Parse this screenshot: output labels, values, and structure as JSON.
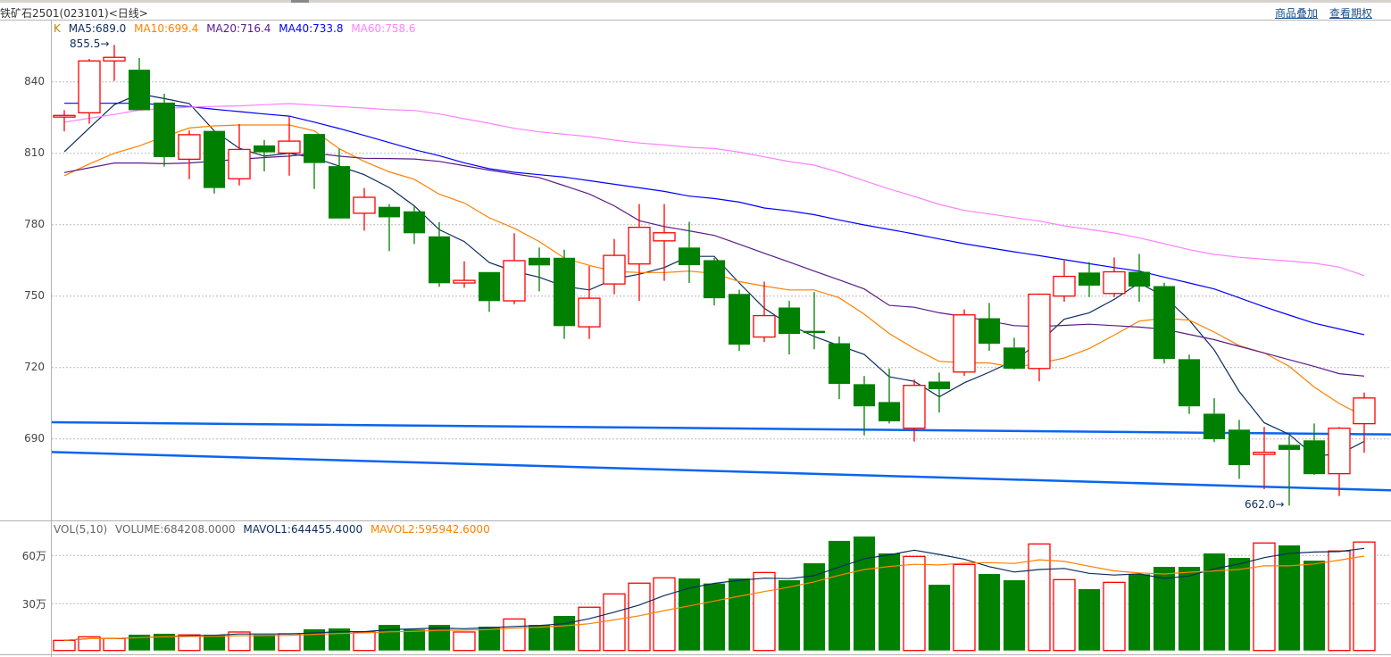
{
  "header": {
    "title": "铁矿石2501(023101)<日线>",
    "links": [
      "商品叠加",
      "查看期权"
    ]
  },
  "legend": {
    "k_label": "K",
    "items": [
      {
        "text": "MA5:689.0",
        "color": "#0b2d5e"
      },
      {
        "text": "MA10:699.4",
        "color": "#ff8000"
      },
      {
        "text": "MA20:716.4",
        "color": "#5a1a8a"
      },
      {
        "text": "MA40:733.8",
        "color": "#0000ff"
      },
      {
        "text": "MA60:758.6",
        "color": "#ff80ff"
      }
    ]
  },
  "volume_legend": {
    "items": [
      {
        "text": "VOL(5,10)",
        "color": "#666666"
      },
      {
        "text": "VOLUME:684208.0000",
        "color": "#666666"
      },
      {
        "text": "MAVOL1:644455.4000",
        "color": "#0b2d5e"
      },
      {
        "text": "MAVOL2:595942.6000",
        "color": "#ff8000"
      }
    ]
  },
  "colors": {
    "up": "#ff0000",
    "down": "#008000",
    "grid": "#bbbbbb",
    "trendline": "#0a64f0"
  },
  "chart_data": {
    "type": "candlestick",
    "title": "铁矿石2501(023101)<日线>",
    "price_axis": {
      "ticks": [
        840,
        810,
        780,
        750,
        720,
        690
      ],
      "tick_labels": [
        "840",
        "810",
        "780",
        "750",
        "720",
        "690"
      ]
    },
    "volume_axis": {
      "unit": "万",
      "ticks": [
        60,
        30
      ],
      "tick_labels": [
        "60万",
        "30万"
      ]
    },
    "grid": true,
    "annotations": [
      {
        "text": "855.5→",
        "candle": 2,
        "price": 855.5,
        "kind": "high"
      },
      {
        "text": "662.0→",
        "candle": 49,
        "price": 662.0,
        "kind": "low"
      }
    ],
    "ohlc": [
      [
        825.2,
        828.1,
        819.2,
        825.9
      ],
      [
        827.0,
        849.6,
        822.4,
        848.8
      ],
      [
        848.8,
        855.5,
        840.4,
        850.3
      ],
      [
        845.1,
        850.0,
        828.1,
        828.1
      ],
      [
        831.3,
        835.0,
        804.4,
        808.4
      ],
      [
        807.5,
        819.6,
        799.1,
        817.8
      ],
      [
        819.4,
        819.4,
        793.1,
        795.4
      ],
      [
        799.3,
        822.3,
        796.5,
        811.6
      ],
      [
        813.3,
        815.6,
        802.4,
        810.4
      ],
      [
        810.1,
        825.4,
        800.6,
        815.1
      ],
      [
        818.1,
        818.1,
        795.0,
        805.9
      ],
      [
        804.6,
        811.9,
        782.6,
        782.6
      ],
      [
        784.8,
        795.4,
        777.5,
        791.5
      ],
      [
        787.5,
        788.6,
        768.9,
        783.1
      ],
      [
        785.6,
        787.6,
        771.9,
        776.4
      ],
      [
        775.1,
        781.1,
        753.9,
        755.4
      ],
      [
        755.5,
        764.6,
        753.5,
        756.6
      ],
      [
        760.1,
        760.1,
        743.4,
        747.9
      ],
      [
        748.0,
        776.4,
        746.6,
        764.9
      ],
      [
        766.1,
        770.4,
        752.0,
        762.9
      ],
      [
        766.1,
        769.5,
        732.0,
        737.4
      ],
      [
        737.1,
        762.6,
        732.0,
        749.1
      ],
      [
        755.1,
        774.0,
        750.8,
        767.1
      ],
      [
        763.5,
        788.7,
        748.0,
        778.9
      ],
      [
        773.2,
        788.7,
        756.4,
        776.6
      ],
      [
        770.4,
        781.2,
        755.5,
        763.0
      ],
      [
        765.1,
        766.0,
        746.1,
        749.1
      ],
      [
        750.9,
        752.7,
        727.0,
        729.6
      ],
      [
        732.8,
        756.1,
        730.7,
        741.8
      ],
      [
        745.2,
        748.0,
        725.5,
        734.1
      ],
      [
        735.4,
        751.7,
        727.7,
        734.5
      ],
      [
        730.2,
        733.0,
        706.7,
        713.1
      ],
      [
        713.0,
        716.4,
        691.5,
        703.7
      ],
      [
        705.5,
        719.6,
        696.5,
        697.4
      ],
      [
        694.5,
        714.9,
        688.9,
        712.5
      ],
      [
        714.1,
        717.9,
        701.1,
        710.9
      ],
      [
        718.1,
        744.4,
        716.5,
        742.1
      ],
      [
        740.7,
        747.1,
        727.0,
        730.0
      ],
      [
        728.4,
        732.5,
        719.2,
        719.5
      ],
      [
        719.6,
        751.1,
        714.2,
        750.8
      ],
      [
        750.0,
        764.9,
        747.6,
        758.3
      ],
      [
        759.9,
        764.3,
        749.6,
        754.4
      ],
      [
        751.1,
        766.2,
        749.6,
        760.2
      ],
      [
        760.2,
        767.7,
        747.6,
        754.0
      ],
      [
        754.2,
        755.6,
        721.7,
        723.6
      ],
      [
        723.5,
        725.4,
        700.5,
        703.7
      ],
      [
        700.6,
        707.1,
        688.7,
        689.9
      ],
      [
        693.9,
        698.0,
        673.2,
        679.0
      ],
      [
        683.5,
        695.0,
        668.9,
        684.4
      ],
      [
        687.5,
        691.5,
        662.0,
        685.4
      ],
      [
        689.4,
        696.5,
        674.9,
        675.2
      ],
      [
        675.4,
        695.0,
        666.0,
        694.5
      ],
      [
        696.4,
        709.5,
        684.2,
        707.2
      ]
    ],
    "volume": [
      7.2,
      9.4,
      8.3,
      10.7,
      11.3,
      10.6,
      10.7,
      12.4,
      10.7,
      11.3,
      14.1,
      14.6,
      12.4,
      16.8,
      13.9,
      16.8,
      12.4,
      15.7,
      20.5,
      16.8,
      22.4,
      27.8,
      36.1,
      42.8,
      46.1,
      45.7,
      42.6,
      45.7,
      49.4,
      44.6,
      55.2,
      69.1,
      71.8,
      61.3,
      59.4,
      41.8,
      54.4,
      48.5,
      44.6,
      67.2,
      45.0,
      39.1,
      43.3,
      48.3,
      52.9,
      52.9,
      61.3,
      58.5,
      67.8,
      66.3,
      56.8,
      62.8,
      68.4
    ],
    "volume_ma": [
      {
        "name": "MAVOL1",
        "period": 5,
        "color": "#0b2d5e"
      },
      {
        "name": "MAVOL2",
        "period": 10,
        "color": "#ff8000"
      }
    ],
    "moving_averages": [
      {
        "name": "MA5",
        "color": "#0b2d5e",
        "values": [
          810.6,
          820.6,
          830.4,
          834.9,
          833.0,
          830.9,
          819.4,
          812.1,
          808.8,
          810.0,
          808.1,
          804.6,
          801.0,
          795.6,
          787.9,
          777.9,
          772.9,
          764.1,
          760.4,
          757.9,
          754.1,
          752.6,
          757.2,
          759.2,
          762.0,
          766.7,
          766.7,
          755.5,
          744.9,
          738.0,
          733.0,
          729.2,
          725.5,
          716.1,
          714.2,
          707.7,
          713.6,
          718.0,
          723.0,
          730.5,
          740.3,
          743.0,
          748.6,
          755.5,
          749.9,
          739.9,
          727.4,
          709.9,
          696.8,
          691.9,
          683.0,
          683.5,
          689.0
        ]
      },
      {
        "name": "MA10",
        "color": "#ff8000",
        "values": [
          800.6,
          805.5,
          810.0,
          813.1,
          817.0,
          820.6,
          821.5,
          821.9,
          821.9,
          821.9,
          819.4,
          811.9,
          806.6,
          802.2,
          799.1,
          792.8,
          789.1,
          782.9,
          778.5,
          772.9,
          766.0,
          762.9,
          760.4,
          759.9,
          759.9,
          760.5,
          759.5,
          756.1,
          754.2,
          752.6,
          752.6,
          749.3,
          742.4,
          734.3,
          728.0,
          722.6,
          722.0,
          721.9,
          720.2,
          721.7,
          724.0,
          728.0,
          733.6,
          739.5,
          740.7,
          739.9,
          734.9,
          729.2,
          726.1,
          720.5,
          711.8,
          704.9,
          699.4
        ]
      },
      {
        "name": "MA20",
        "color": "#5a1a8a",
        "values": [
          801.9,
          803.9,
          805.9,
          805.9,
          805.6,
          805.9,
          806.7,
          807.5,
          808.2,
          808.8,
          810.0,
          808.8,
          807.9,
          807.8,
          807.6,
          806.6,
          804.8,
          802.9,
          801.3,
          799.8,
          796.4,
          792.9,
          787.9,
          781.7,
          779.2,
          777.4,
          775.5,
          771.8,
          768.0,
          764.3,
          760.5,
          756.8,
          753.0,
          746.1,
          745.3,
          743.0,
          741.4,
          739.5,
          737.6,
          737.2,
          737.7,
          738.2,
          737.6,
          737.0,
          736.1,
          733.9,
          731.7,
          728.9,
          726.1,
          723.3,
          720.5,
          717.4,
          716.4
        ]
      },
      {
        "name": "MA40",
        "color": "#0000ff",
        "values": [
          831.0,
          831.0,
          831.0,
          831.0,
          830.3,
          829.6,
          828.5,
          827.5,
          826.5,
          825.6,
          823.1,
          820.4,
          817.5,
          814.5,
          811.5,
          809.0,
          806.0,
          803.5,
          802.0,
          801.0,
          800.0,
          798.5,
          797.0,
          795.5,
          794.0,
          792.0,
          791.0,
          789.5,
          787.0,
          785.8,
          784.2,
          782.0,
          779.9,
          778.0,
          776.1,
          774.0,
          772.0,
          770.3,
          768.6,
          767.0,
          765.3,
          763.6,
          762.0,
          760.5,
          758.0,
          755.5,
          753.0,
          749.3,
          745.5,
          742.0,
          738.6,
          736.2,
          733.8
        ]
      },
      {
        "name": "MA60",
        "color": "#ff80ff",
        "values": [
          823.1,
          824.7,
          826.3,
          828.1,
          828.8,
          829.4,
          829.7,
          829.9,
          830.4,
          830.9,
          830.2,
          829.6,
          829.0,
          828.3,
          828.0,
          826.5,
          824.5,
          822.6,
          820.5,
          819.0,
          818.0,
          817.0,
          815.5,
          814.3,
          813.5,
          812.5,
          812.0,
          810.5,
          808.5,
          806.5,
          805.0,
          802.0,
          798.5,
          795.0,
          791.9,
          788.5,
          786.0,
          784.5,
          783.0,
          781.5,
          779.5,
          778.0,
          776.5,
          774.5,
          772.0,
          769.5,
          767.5,
          766.3,
          765.5,
          764.7,
          763.8,
          762.2,
          758.6
        ]
      }
    ],
    "trendlines": [
      {
        "name": "upper-support",
        "start_price": 697.0,
        "end_price": 691.9
      },
      {
        "name": "lower-support",
        "start_price": 684.5,
        "end_price": 668.4
      }
    ]
  }
}
